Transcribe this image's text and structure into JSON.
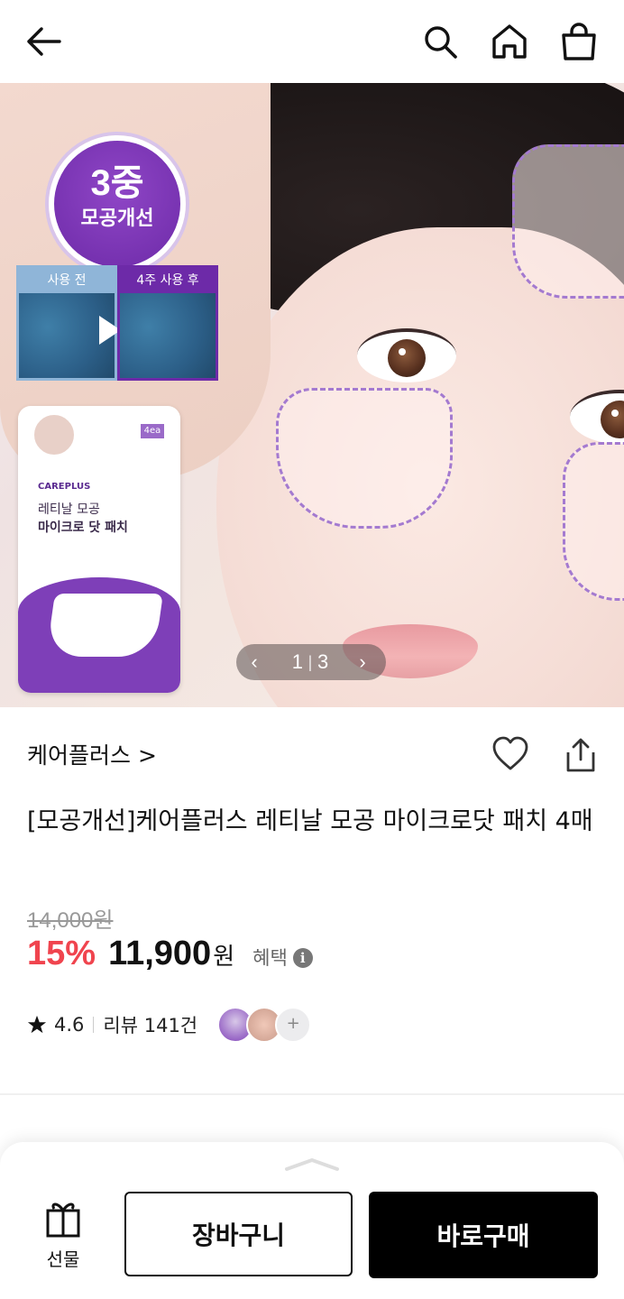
{
  "header": {
    "back_icon": "arrow-left-icon",
    "search_icon": "search-icon",
    "home_icon": "home-icon",
    "bag_icon": "shopping-bag-icon"
  },
  "hero": {
    "badge_line1": "3중",
    "badge_line2": "모공개선",
    "before_label": "사용 전",
    "after_label": "4주 사용 후",
    "package": {
      "brand": "CAREPLUS",
      "count_tag": "4ea",
      "name_line1": "레티날 모공",
      "name_line2": "마이크로 닷 패치"
    },
    "pager": {
      "current": "1",
      "separator": "|",
      "total": "3",
      "prev_icon": "chevron-left-icon",
      "next_icon": "chevron-right-icon"
    }
  },
  "product": {
    "brand": "케어플러스 >",
    "title": "[모공개선]케어플러스 레티날 모공 마이크로닷 패치 4매",
    "original_price": "14,000원",
    "discount": "15%",
    "price": "11,900",
    "currency": "원",
    "benefit_label": "혜택",
    "benefit_info": "i",
    "rating": "4.6",
    "review_label": "리뷰 141건",
    "more_thumbs": "+"
  },
  "bottom_bar": {
    "gift_label": "선물",
    "cart_label": "장바구니",
    "buy_label": "바로구매"
  },
  "colors": {
    "discount": "#f0444e",
    "accent_purple": "#6d2aa8",
    "buy_button": "#000000"
  }
}
